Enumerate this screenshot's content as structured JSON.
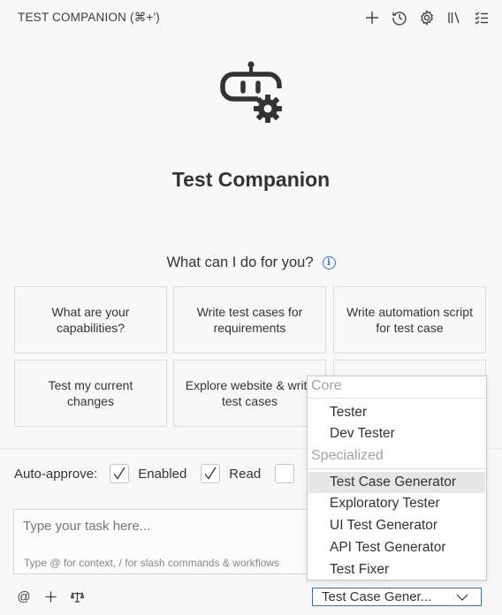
{
  "header": {
    "title": "TEST COMPANION (⌘+')",
    "actions": [
      "plus-icon",
      "history-icon",
      "gear-icon",
      "library-icon",
      "tasklist-icon"
    ]
  },
  "hero": {
    "title": "Test Companion",
    "prompt": "What can I do for you?"
  },
  "cards": [
    "What are your\ncapabilities?",
    "Write test cases for\nrequirements",
    "Write automation script\nfor test case",
    "Test my current\nchanges",
    "Explore website & write\ntest cases",
    ""
  ],
  "auto_approve": {
    "label": "Auto-approve:",
    "options": [
      {
        "label": "Enabled",
        "checked": true
      },
      {
        "label": "Read",
        "checked": true
      },
      {
        "label": "",
        "checked": false
      }
    ]
  },
  "task": {
    "placeholder": "Type your task here...",
    "hint": "Type @ for context, / for slash commands & workflows"
  },
  "bottom_icons": [
    "at-icon",
    "add-icon",
    "scale-icon"
  ],
  "mode_dropdown": {
    "groups": [
      {
        "label": "Core",
        "items": [
          "Tester",
          "Dev Tester"
        ]
      },
      {
        "label": "Specialized",
        "items": [
          "Test Case Generator",
          "Exploratory Tester",
          "UI Test Generator",
          "API Test Generator",
          "Test Fixer"
        ]
      }
    ],
    "selected": "Test Case Generator",
    "display": "Test Case Gener..."
  },
  "colors": {
    "background": "#f8f8f8",
    "accent": "#2f6fe0",
    "selection": "#e6e6e6"
  }
}
